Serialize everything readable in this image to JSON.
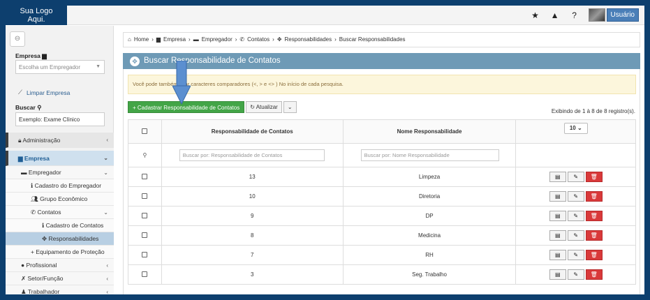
{
  "logo": {
    "line1": "Sua Logo",
    "line2": "Aqui."
  },
  "topbar": {
    "icons": [
      "star-icon",
      "warning-icon",
      "help-icon"
    ],
    "user_label": "Usuário"
  },
  "sidebar": {
    "empresa_label": "Empresa",
    "empresa_select": "Escolha um Empregador",
    "clear_label": "Limpar Empresa",
    "search_label": "Buscar",
    "search_value": "Exemplo: Exame Clínico",
    "menu": {
      "administracao": "Administração",
      "empresa": "Empresa",
      "empregador": "Empregador",
      "cadastro_empregador": "Cadastro do Empregador",
      "grupo_economico": "Grupo Econômico",
      "contatos": "Contatos",
      "cadastro_contatos": "Cadastro de Contatos",
      "responsabilidades": "Responsabilidades",
      "equipamento": "Equipamento de Proteção",
      "profissional": "Profissional",
      "setor_funcao": "Setor/Função",
      "trabalhador": "Trabalhador"
    }
  },
  "breadcrumb": [
    "Home",
    "Empresa",
    "Empregador",
    "Contatos",
    "Responsabilidades",
    "Buscar Responsabilidades"
  ],
  "panel": {
    "title": "Buscar Responsabilidade de Contatos",
    "alert": "Você pode também usar caracteres comparadores (<, > e <> ) No início de cada pesquisa.",
    "add_button": "+ Cadastrar Responsabilidade de Contatos",
    "refresh_button": "Atualizar",
    "info": "Exibindo de 1 à 8 de 8 registro(s).",
    "page_size": "10"
  },
  "table": {
    "col1": "Responsabilidade de Contatos",
    "col2": "Nome Responsabilidade",
    "filter1_placeholder": "Buscar por: Responsabilidade de Contatos",
    "filter2_placeholder": "Buscar por: Nome Responsabilidade",
    "rows": [
      {
        "id": "13",
        "name": "Limpeza"
      },
      {
        "id": "10",
        "name": "Diretoria"
      },
      {
        "id": "9",
        "name": "DP"
      },
      {
        "id": "8",
        "name": "Medicina"
      },
      {
        "id": "7",
        "name": "RH"
      },
      {
        "id": "3",
        "name": "Seg. Trabalho"
      }
    ]
  }
}
